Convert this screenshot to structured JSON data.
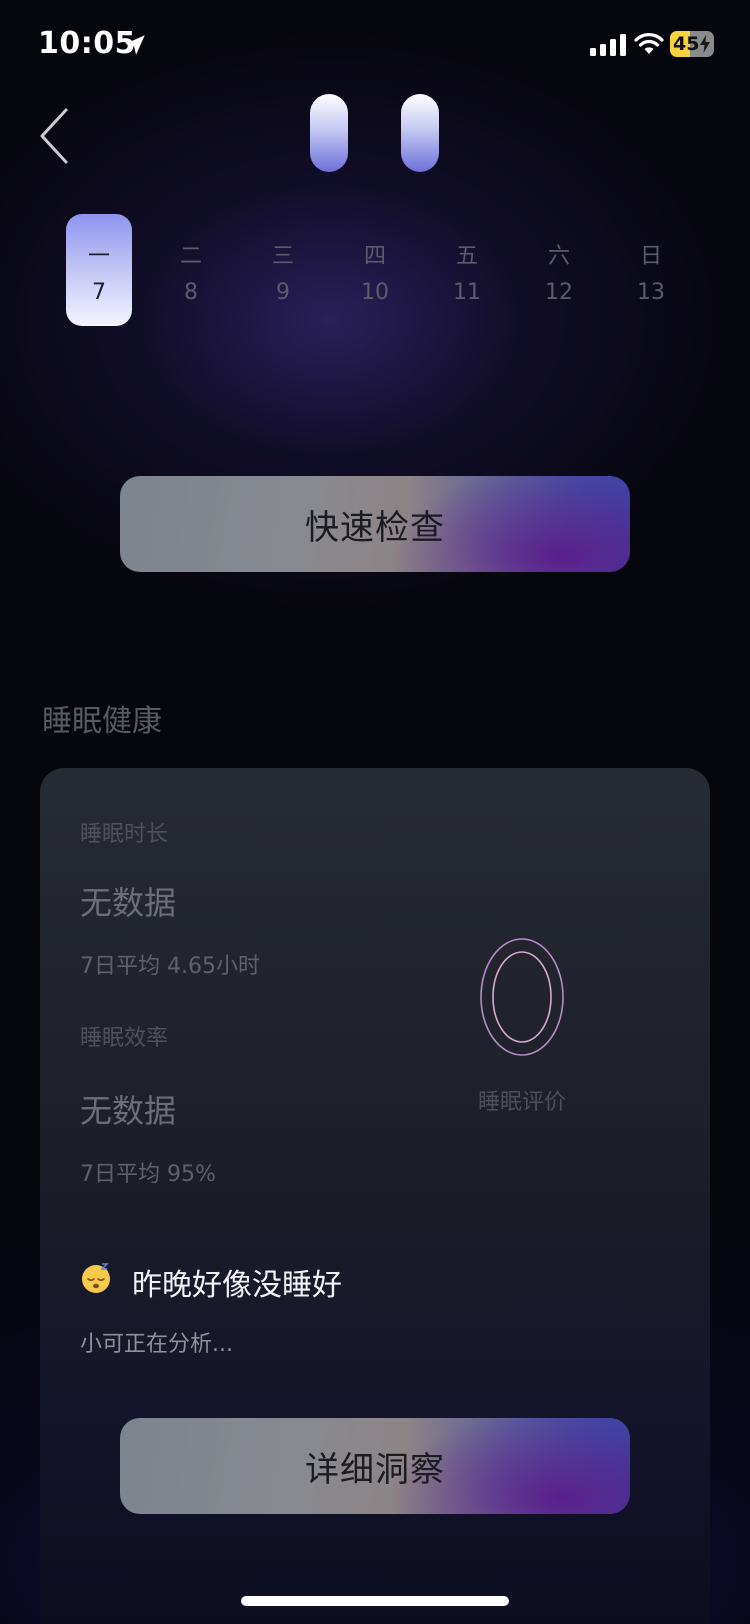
{
  "status_bar": {
    "time": "10:05",
    "battery_level": "45",
    "icons": [
      "location-arrow-icon",
      "signal-icon",
      "wifi-icon",
      "battery-charging-icon"
    ]
  },
  "header": {
    "back_icon": "chevron-left-icon"
  },
  "week": {
    "days": [
      {
        "weekday": "一",
        "date": "7",
        "selected": true
      },
      {
        "weekday": "二",
        "date": "8",
        "selected": false
      },
      {
        "weekday": "三",
        "date": "9",
        "selected": false
      },
      {
        "weekday": "四",
        "date": "10",
        "selected": false
      },
      {
        "weekday": "五",
        "date": "11",
        "selected": false
      },
      {
        "weekday": "六",
        "date": "12",
        "selected": false
      },
      {
        "weekday": "日",
        "date": "13",
        "selected": false
      }
    ]
  },
  "quick_check": {
    "label": "快速检查"
  },
  "sleep_health": {
    "section_title": "睡眠健康",
    "duration": {
      "label": "睡眠时长",
      "value": "无数据",
      "avg": "7日平均 4.65小时"
    },
    "efficiency": {
      "label": "睡眠效率",
      "value": "无数据",
      "avg": "7日平均 95%"
    },
    "score_label": "睡眠评价",
    "insight": {
      "emoji_icon": "sleeping-face-icon",
      "title": "昨晚好像没睡好",
      "subtitle": "小可正在分析..."
    },
    "detail_button": "详细洞察"
  },
  "colors": {
    "accent": "#7d82e6",
    "background": "#06060d",
    "card": "#22252f"
  }
}
